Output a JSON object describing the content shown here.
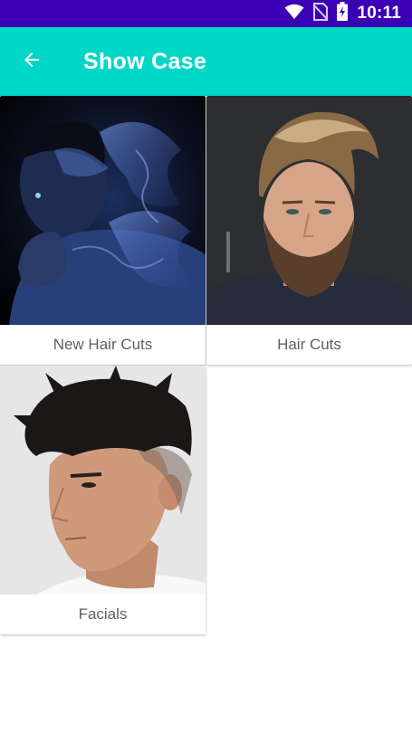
{
  "status_bar": {
    "time": "10:11",
    "icons": [
      "wifi-icon",
      "no-sim-icon",
      "battery-charging-icon"
    ],
    "background": "#3b00b3"
  },
  "app_bar": {
    "title": "Show Case",
    "back_icon": "arrow-left-icon",
    "background": "#00d7c7"
  },
  "categories": [
    {
      "label": "New Hair Cuts",
      "image": "smoke-portrait-image"
    },
    {
      "label": "Hair Cuts",
      "image": "pompadour-beard-portrait-image"
    },
    {
      "label": "Facials",
      "image": "side-profile-haircut-image"
    }
  ]
}
